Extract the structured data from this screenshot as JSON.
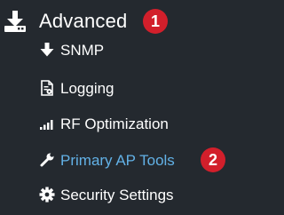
{
  "menu": {
    "header": {
      "label": "Advanced",
      "icon": "download-tray-icon",
      "badge": "1"
    },
    "items": [
      {
        "label": "SNMP",
        "icon": "arrow-down-icon",
        "active": false
      },
      {
        "label": "Logging",
        "icon": "document-log-icon",
        "active": false
      },
      {
        "label": "RF Optimization",
        "icon": "signal-bars-icon",
        "active": false
      },
      {
        "label": "Primary AP Tools",
        "icon": "wrench-icon",
        "active": true,
        "badge": "2"
      },
      {
        "label": "Security Settings",
        "icon": "gear-icon",
        "active": false
      }
    ]
  },
  "colors": {
    "background": "#24292f",
    "text": "#ffffff",
    "active_text": "#62b1e6",
    "badge": "#d21f2b"
  }
}
